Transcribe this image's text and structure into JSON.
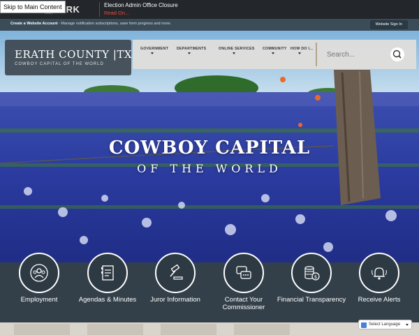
{
  "skip_link": "Skip to Main Content",
  "alert": {
    "brand": "ORK",
    "title": "Election Admin Office Closure",
    "read_on": "Read On..."
  },
  "account_bar": {
    "create_label": "Create a Website Account",
    "create_desc": " - Manage notification subscriptions, save form progress and more.",
    "sign_in": "Website Sign In"
  },
  "logo": {
    "title": "ERATH COUNTY |TX",
    "subtitle": "COWBOY CAPITAL OF THE WORLD"
  },
  "nav": [
    {
      "label": "GOVERNMENT"
    },
    {
      "label": "DEPARTMENTS"
    },
    {
      "label": "ONLINE SERVICES"
    },
    {
      "label": "COMMUNITY"
    },
    {
      "label": "HOW DO I..."
    }
  ],
  "search": {
    "placeholder": "Search..."
  },
  "hero": {
    "title": "COWBOY CAPITAL",
    "subtitle": "OF THE WORLD"
  },
  "quick_links": [
    {
      "label": "Employment",
      "icon": "people-group-icon"
    },
    {
      "label": "Agendas & Minutes",
      "icon": "document-icon"
    },
    {
      "label": "Juror Information",
      "icon": "gavel-icon"
    },
    {
      "label": "Contact Your Commissioner",
      "icon": "chat-bubbles-icon"
    },
    {
      "label": "Financial Transparency",
      "icon": "coins-icon"
    },
    {
      "label": "Receive Alerts",
      "icon": "bell-icon"
    }
  ],
  "language": {
    "label": "Select Language"
  },
  "colors": {
    "header_dark": "#23262a",
    "account_bar": "#3b4c59",
    "quick_links_bg": "#34404a",
    "alert_accent": "#e74c3c"
  }
}
